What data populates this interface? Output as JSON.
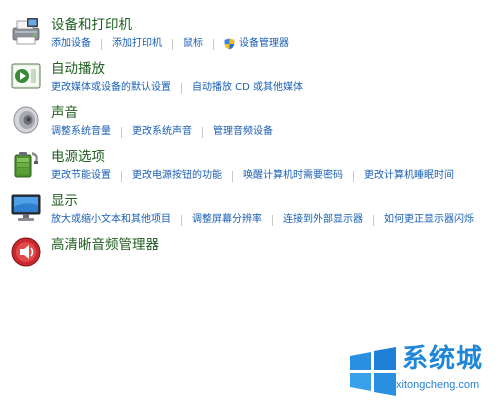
{
  "sections": [
    {
      "title": "设备和打印机",
      "icon": "printer-icon",
      "links": [
        "添加设备",
        "添加打印机",
        "鼠标",
        "设备管理器"
      ]
    },
    {
      "title": "自动播放",
      "icon": "autoplay-icon",
      "links": [
        "更改媒体或设备的默认设置",
        "自动播放 CD 或其他媒体"
      ]
    },
    {
      "title": "声音",
      "icon": "speaker-icon",
      "links": [
        "调整系统音量",
        "更改系统声音",
        "管理音频设备"
      ]
    },
    {
      "title": "电源选项",
      "icon": "battery-icon",
      "links": [
        "更改节能设置",
        "更改电源按钮的功能",
        "唤醒计算机时需要密码",
        "更改计算机睡眠时间"
      ]
    },
    {
      "title": "显示",
      "icon": "monitor-icon",
      "links": [
        "放大或缩小文本和其他项目",
        "调整屏幕分辨率",
        "连接到外部显示器",
        "如何更正显示器闪烁"
      ]
    },
    {
      "title": "高清晰音频管理器",
      "icon": "audio-manager-icon",
      "links": []
    }
  ],
  "watermark": {
    "brand": "系统城",
    "domain": "xitongcheng.com",
    "icon": "windows-logo-icon",
    "color": "#1f87d6"
  },
  "colors": {
    "title": "#1e5e1e",
    "link": "#1a5fb4"
  }
}
